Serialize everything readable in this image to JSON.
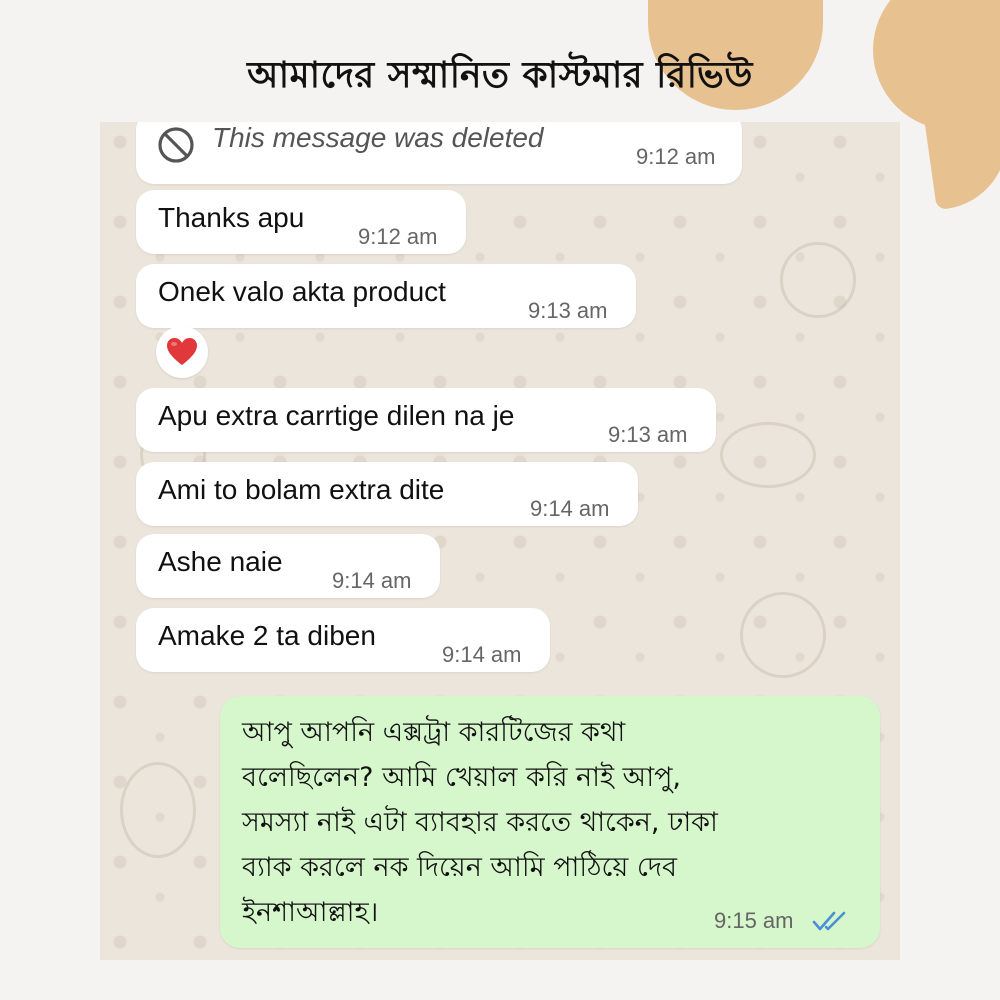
{
  "page": {
    "title": "আমাদের সম্মানিত কাস্টমার রিভিউ"
  },
  "colors": {
    "accent_blob": "#e7c190",
    "incoming_bubble": "#ffffff",
    "outgoing_bubble": "#d6f6cb",
    "read_ticks": "#4a8fd6"
  },
  "messages": [
    {
      "text": "This message was deleted",
      "time": "9:12 am",
      "deleted": true,
      "icon": "blocked-icon"
    },
    {
      "text": "Thanks apu",
      "time": "9:12 am"
    },
    {
      "text": "Onek valo akta product",
      "time": "9:13 am",
      "reaction": "❤️"
    },
    {
      "text": "Apu extra carrtige dilen na je",
      "time": "9:13 am"
    },
    {
      "text": "Ami to bolam extra dite",
      "time": "9:14 am"
    },
    {
      "text": "Ashe naie",
      "time": "9:14 am"
    },
    {
      "text": "Amake 2 ta diben",
      "time": "9:14 am"
    }
  ],
  "reply": {
    "lines": [
      "আপু আপনি এক্সট্রা কারটিজের কথা",
      "বলেছিলেন?  আমি খেয়াল করি নাই আপু,",
      "সমস্যা নাই এটা ব্যাবহার করতে থাকেন, ঢাকা",
      "ব্যাক করলে নক দিয়েন আমি পাঠিয়ে দেব",
      "ইনশাআল্লাহ।"
    ],
    "time": "9:15 am",
    "status_icon": "double-check-icon"
  }
}
